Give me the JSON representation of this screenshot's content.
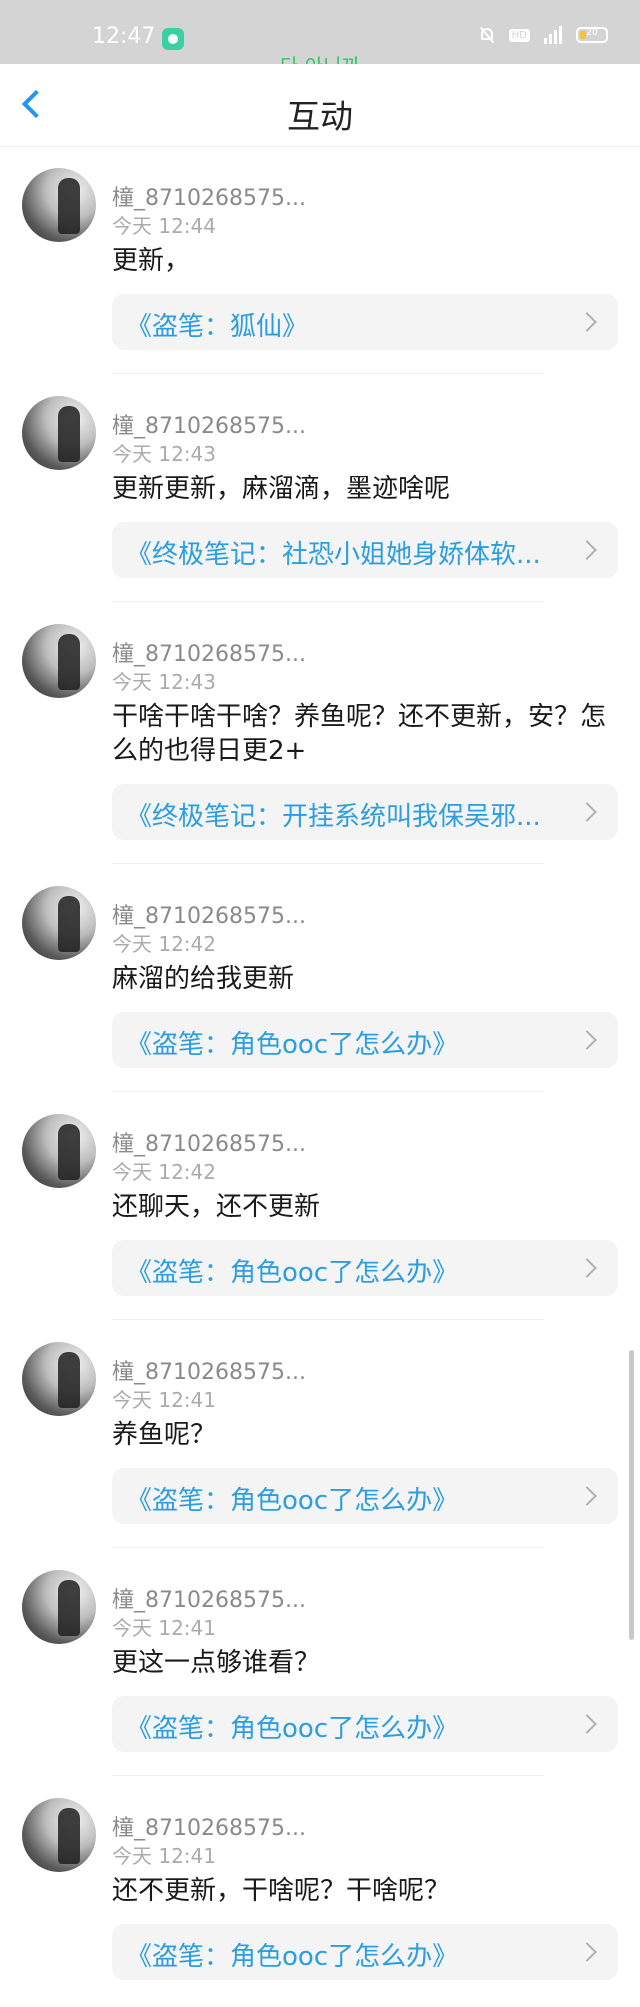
{
  "status_bar": {
    "time": "12:47",
    "battery": "20",
    "network": "HD",
    "signal": "4G"
  },
  "overlay_text": "다 아니까",
  "header": {
    "title": "互动"
  },
  "comments": [
    {
      "user": "橦_8710268575...",
      "time": "今天 12:44",
      "text": "更新，",
      "book": "《盗笔：狐仙》"
    },
    {
      "user": "橦_8710268575...",
      "time": "今天 12:43",
      "text": "更新更新，麻溜滴，墨迹啥呢",
      "book": "《终极笔记：社恐小姐她身娇体软..."
    },
    {
      "user": "橦_8710268575...",
      "time": "今天 12:43",
      "text": "干啥干啥干啥？养鱼呢？还不更新，安？怎么的也得日更2+",
      "book": "《终极笔记：开挂系统叫我保吴邪..."
    },
    {
      "user": "橦_8710268575...",
      "time": "今天 12:42",
      "text": "麻溜的给我更新",
      "book": "《盗笔：角色ooc了怎么办》"
    },
    {
      "user": "橦_8710268575...",
      "time": "今天 12:42",
      "text": "还聊天，还不更新",
      "book": "《盗笔：角色ooc了怎么办》"
    },
    {
      "user": "橦_8710268575...",
      "time": "今天 12:41",
      "text": "养鱼呢？",
      "book": "《盗笔：角色ooc了怎么办》"
    },
    {
      "user": "橦_8710268575...",
      "time": "今天 12:41",
      "text": "更这一点够谁看？",
      "book": "《盗笔：角色ooc了怎么办》"
    },
    {
      "user": "橦_8710268575...",
      "time": "今天 12:41",
      "text": "还不更新，干啥呢？干啥呢？",
      "book": "《盗笔：角色ooc了怎么办》"
    }
  ]
}
